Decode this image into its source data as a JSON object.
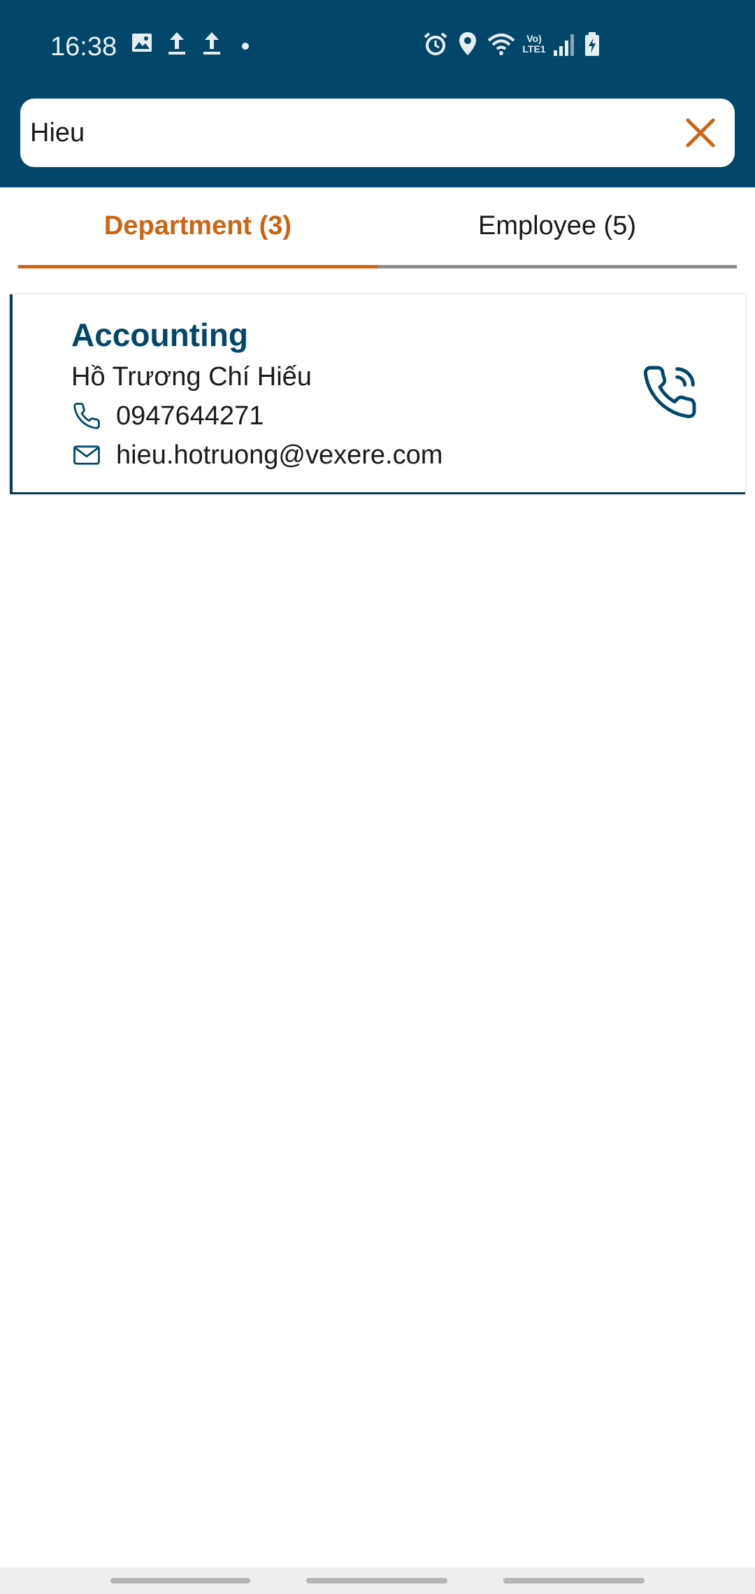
{
  "status_bar": {
    "time": "16:38",
    "icons": [
      "image-icon",
      "upload-icon",
      "upload-icon",
      "dot-icon",
      "alarm-icon",
      "location-icon",
      "wifi-icon",
      "volte-icon",
      "signal-icon",
      "battery-charging-icon"
    ],
    "volte_text": "Vo) LTE1"
  },
  "search": {
    "value": "Hieu",
    "placeholder": ""
  },
  "tabs": [
    {
      "label": "Department (3)",
      "active": true
    },
    {
      "label": "Employee (5)",
      "active": false
    }
  ],
  "results": [
    {
      "department": "Accounting",
      "person": "Hồ Trương Chí Hiếu",
      "phone": "0947644271",
      "email": "hieu.hotruong@vexere.com"
    }
  ],
  "colors": {
    "header": "#02476b",
    "accent": "#cc6414",
    "card_title": "#02476b",
    "tab_inactive_line": "#8c8c8c"
  }
}
